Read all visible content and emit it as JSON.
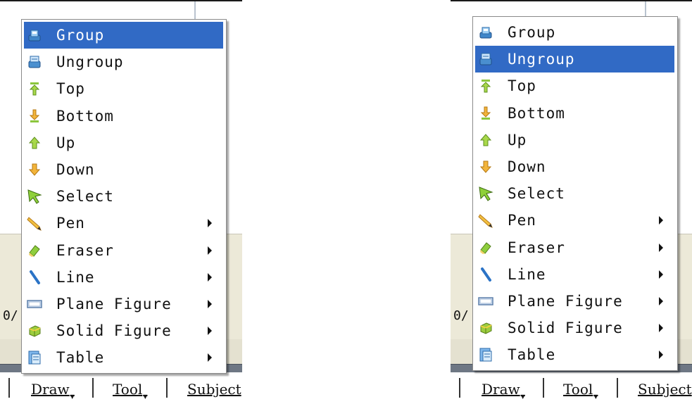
{
  "menu_items": [
    {
      "label": "Group",
      "icon": "group-icon",
      "submenu": false
    },
    {
      "label": "Ungroup",
      "icon": "ungroup-icon",
      "submenu": false
    },
    {
      "label": "Top",
      "icon": "top-icon",
      "submenu": false
    },
    {
      "label": "Bottom",
      "icon": "bottom-icon",
      "submenu": false
    },
    {
      "label": "Up",
      "icon": "up-icon",
      "submenu": false
    },
    {
      "label": "Down",
      "icon": "down-icon",
      "submenu": false
    },
    {
      "label": "Select",
      "icon": "select-icon",
      "submenu": false
    },
    {
      "label": "Pen",
      "icon": "pen-icon",
      "submenu": true
    },
    {
      "label": "Eraser",
      "icon": "eraser-icon",
      "submenu": true
    },
    {
      "label": "Line",
      "icon": "line-icon",
      "submenu": true
    },
    {
      "label": "Plane Figure",
      "icon": "plane-figure-icon",
      "submenu": true
    },
    {
      "label": "Solid Figure",
      "icon": "solid-figure-icon",
      "submenu": true
    },
    {
      "label": "Table",
      "icon": "table-icon",
      "submenu": true
    }
  ],
  "menubar": {
    "draw": "Draw",
    "tool": "Tool",
    "subject": "Subject"
  },
  "side_text": "0/",
  "panels": [
    {
      "highlighted_index": 0
    },
    {
      "highlighted_index": 1
    }
  ],
  "colors": {
    "highlight": "#316ac5",
    "menu_bg": "#ffffff",
    "toolbar": "#6e7784"
  }
}
